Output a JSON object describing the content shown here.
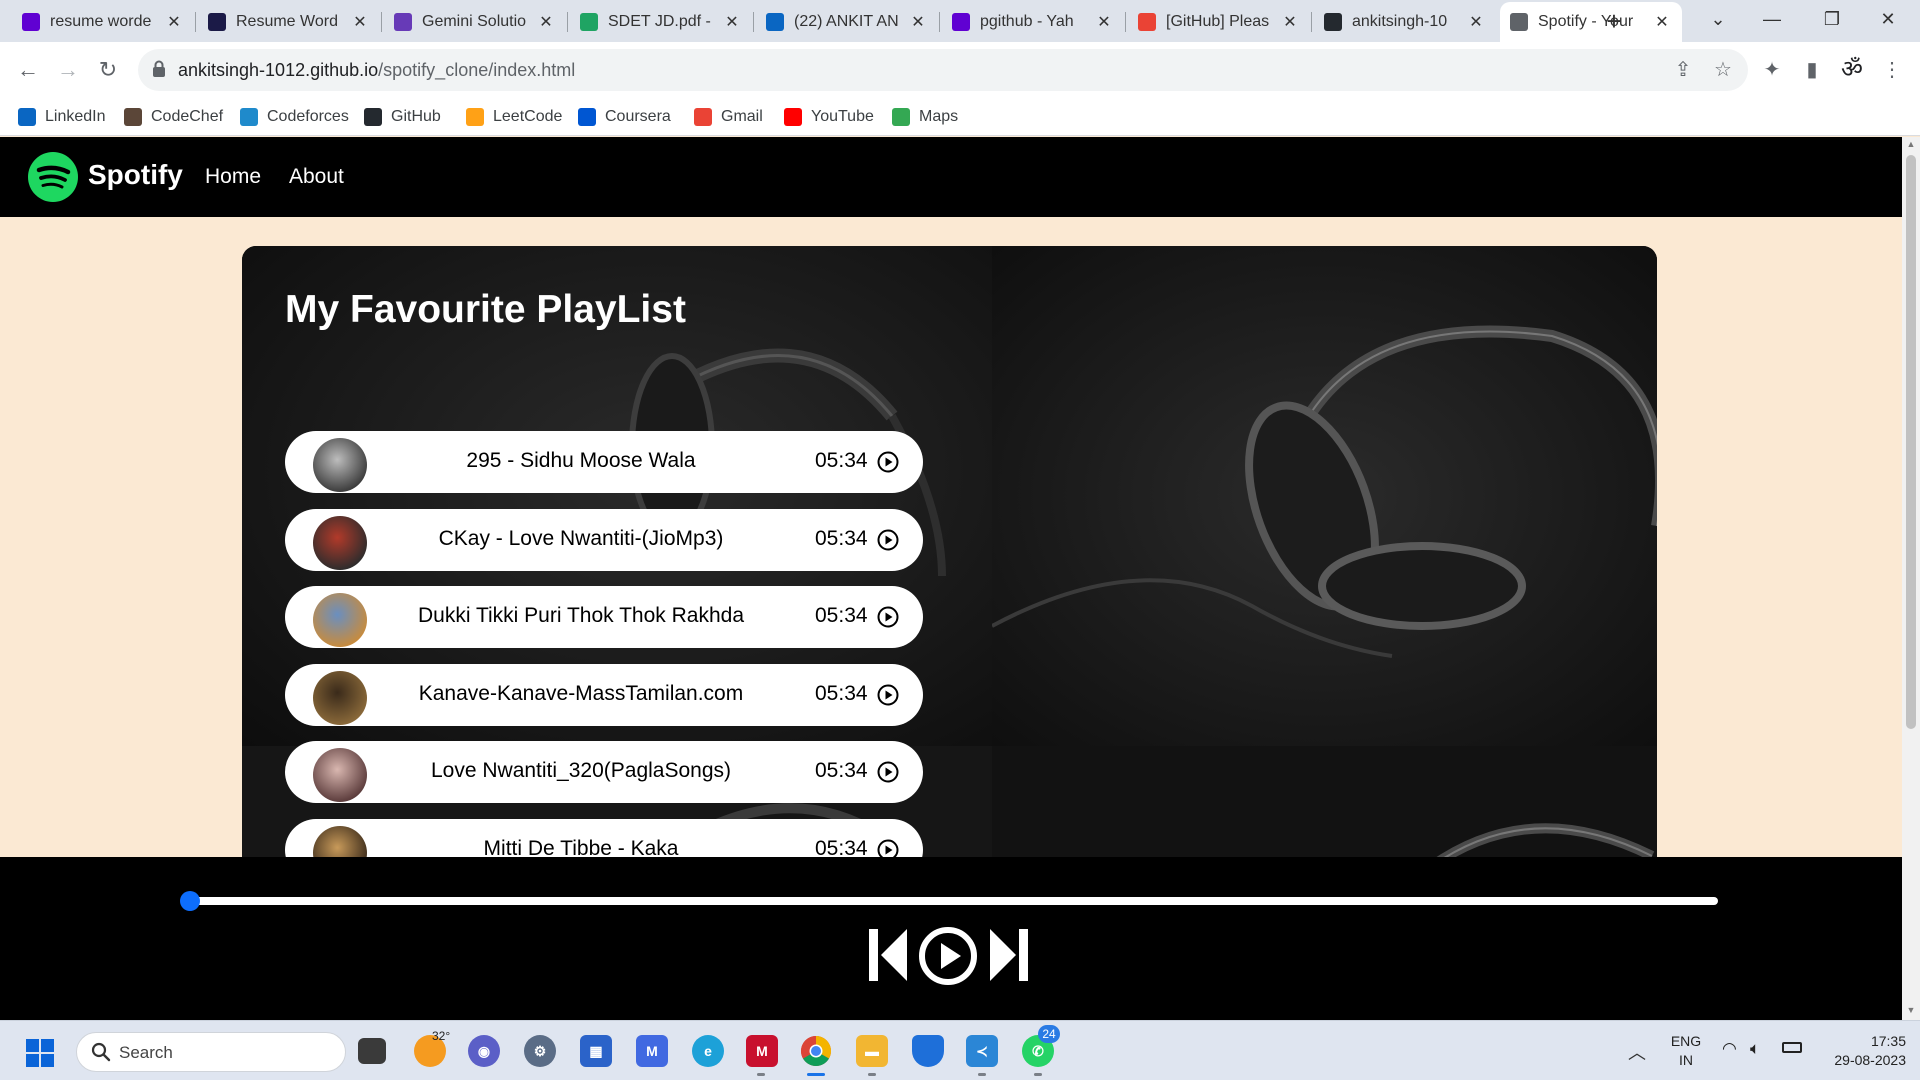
{
  "browser": {
    "tabs": [
      {
        "title": "resume worde",
        "favicon": "yahoo-icon",
        "color": "#6001d2",
        "active": false
      },
      {
        "title": "Resume Word",
        "favicon": "resume-worded-icon",
        "color": "#1b1a47",
        "active": false
      },
      {
        "title": "Gemini Solutio",
        "favicon": "forms-icon",
        "color": "#673ab7",
        "active": false
      },
      {
        "title": "SDET JD.pdf -",
        "favicon": "google-drive-icon",
        "color": "#1fa463",
        "active": false
      },
      {
        "title": "(22) ANKIT AN",
        "favicon": "linkedin-icon",
        "color": "#0a66c2",
        "active": false
      },
      {
        "title": "pgithub - Yah",
        "favicon": "yahoo-icon",
        "color": "#6001d2",
        "active": false
      },
      {
        "title": "[GitHub] Pleas",
        "favicon": "gmail-icon",
        "color": "#ea4335",
        "active": false
      },
      {
        "title": "ankitsingh-10",
        "favicon": "github-icon",
        "color": "#24292f",
        "active": false
      },
      {
        "title": "Spotify - Your",
        "favicon": "globe-icon",
        "color": "#5f6368",
        "active": true
      }
    ],
    "url_host": "ankitsingh-1012.github.io",
    "url_path": "/spotify_clone/index.html",
    "bookmarks": [
      {
        "label": "LinkedIn",
        "icon": "linkedin-icon",
        "color": "#0a66c2"
      },
      {
        "label": "CodeChef",
        "icon": "codechef-icon",
        "color": "#5b4638"
      },
      {
        "label": "Codeforces",
        "icon": "codeforces-icon",
        "color": "#1f8acb"
      },
      {
        "label": "GitHub",
        "icon": "github-icon",
        "color": "#24292f"
      },
      {
        "label": "LeetCode",
        "icon": "leetcode-icon",
        "color": "#ffa116"
      },
      {
        "label": "Coursera",
        "icon": "coursera-icon",
        "color": "#0056d2"
      },
      {
        "label": "Gmail",
        "icon": "gmail-icon",
        "color": "#ea4335"
      },
      {
        "label": "YouTube",
        "icon": "youtube-icon",
        "color": "#ff0000"
      },
      {
        "label": "Maps",
        "icon": "maps-icon",
        "color": "#34a853"
      }
    ]
  },
  "site": {
    "brand": "Spotify",
    "nav": [
      "Home",
      "About"
    ],
    "playlist_title": "My Favourite PlayList",
    "songs": [
      {
        "name": "295 - Sidhu Moose Wala",
        "duration": "05:34"
      },
      {
        "name": "CKay - Love Nwantiti-(JioMp3)",
        "duration": "05:34"
      },
      {
        "name": "Dukki Tikki Puri Thok Thok Rakhda",
        "duration": "05:34"
      },
      {
        "name": "Kanave-Kanave-MassTamilan.com",
        "duration": "05:34"
      },
      {
        "name": "Love Nwantiti_320(PaglaSongs)",
        "duration": "05:34"
      },
      {
        "name": "Mitti De Tibbe - Kaka",
        "duration": "05:34"
      }
    ],
    "progress_fraction": 0.0,
    "accent": "#0d6efd",
    "spotify_green": "#1ed760"
  },
  "taskbar": {
    "search_placeholder": "Search",
    "weather_temp": "32°",
    "whatsapp_badge": "24",
    "lang_top": "ENG",
    "lang_bottom": "IN",
    "time": "17:35",
    "date": "29-08-2023"
  }
}
